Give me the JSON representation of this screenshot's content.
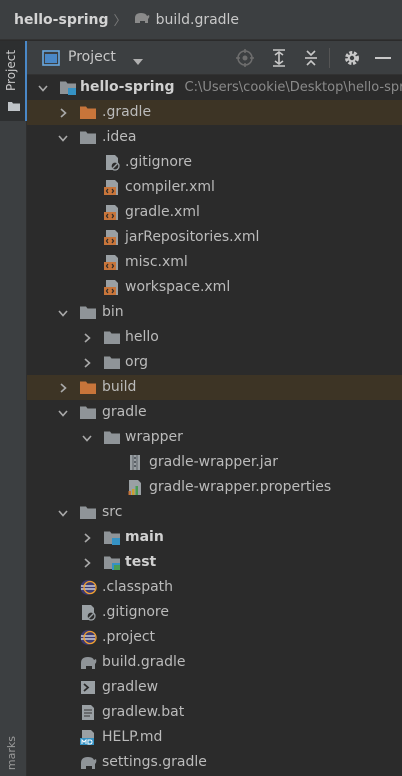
{
  "breadcrumb": {
    "project": "hello-spring",
    "separator": "〉",
    "file": "build.gradle"
  },
  "left_strip": {
    "project_tab": "Project",
    "bottom_tab": "marks"
  },
  "panel": {
    "title": "Project"
  },
  "tree": {
    "root_name": "hello-spring",
    "root_path": "C:\\Users\\cookie\\Desktop\\hello-spring",
    "items": [
      {
        "label": ".gradle"
      },
      {
        "label": ".idea"
      },
      {
        "label": ".gitignore"
      },
      {
        "label": "compiler.xml"
      },
      {
        "label": "gradle.xml"
      },
      {
        "label": "jarRepositories.xml"
      },
      {
        "label": "misc.xml"
      },
      {
        "label": "workspace.xml"
      },
      {
        "label": "bin"
      },
      {
        "label": "hello"
      },
      {
        "label": "org"
      },
      {
        "label": "build"
      },
      {
        "label": "gradle"
      },
      {
        "label": "wrapper"
      },
      {
        "label": "gradle-wrapper.jar"
      },
      {
        "label": "gradle-wrapper.properties"
      },
      {
        "label": "src"
      },
      {
        "label": "main"
      },
      {
        "label": "test"
      },
      {
        "label": ".classpath"
      },
      {
        "label": ".gitignore"
      },
      {
        "label": ".project"
      },
      {
        "label": "build.gradle"
      },
      {
        "label": "gradlew"
      },
      {
        "label": "gradlew.bat"
      },
      {
        "label": "HELP.md"
      },
      {
        "label": "settings.gradle"
      }
    ]
  },
  "colors": {
    "folder": "#8f9498",
    "excluded_folder": "#c8753a",
    "excluded_row": "#3d3425",
    "xml_orange": "#c8753a",
    "accent_blue": "#4a88c7",
    "source_blue": "#3592c4",
    "test_green": "#499c54"
  }
}
